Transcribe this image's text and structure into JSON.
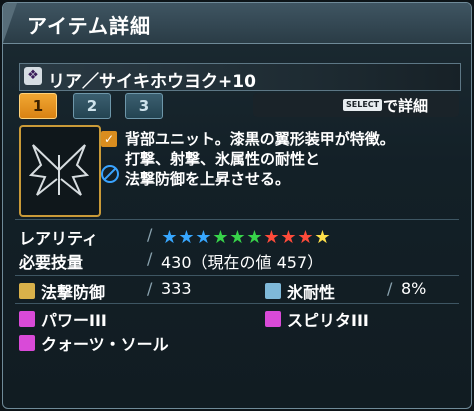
{
  "window": {
    "title": "アイテム詳細"
  },
  "item": {
    "name": "リア／サイキホウヨク+10"
  },
  "tabs": [
    {
      "label": "1",
      "active": true
    },
    {
      "label": "2",
      "active": false
    },
    {
      "label": "3",
      "active": false
    }
  ],
  "select_hint": {
    "badge": "SELECT",
    "text": "で詳細"
  },
  "description": [
    "背部ユニット。漆黒の翼形装甲が特徴。",
    "打撃、射撃、氷属性の耐性と",
    "法撃防御を上昇させる。"
  ],
  "stats": {
    "rarity_label": "レアリティ",
    "rarity_stars": 10,
    "star_colors": [
      "#37a7ff",
      "#37a7ff",
      "#37a7ff",
      "#37d44a",
      "#37d44a",
      "#37d44a",
      "#ff4b3a",
      "#ff4b3a",
      "#ff4b3a",
      "#ffe04a"
    ],
    "skill_label": "必要技量",
    "skill_value": "430（現在の値 457）"
  },
  "properties": {
    "tech_def_label": "法撃防御",
    "tech_def_value": "333",
    "ice_res_label": "氷耐性",
    "ice_res_value": "8%"
  },
  "affixes": [
    {
      "label": "パワーIII"
    },
    {
      "label": "スピリタIII"
    },
    {
      "label": "クォーツ・ソール"
    }
  ]
}
